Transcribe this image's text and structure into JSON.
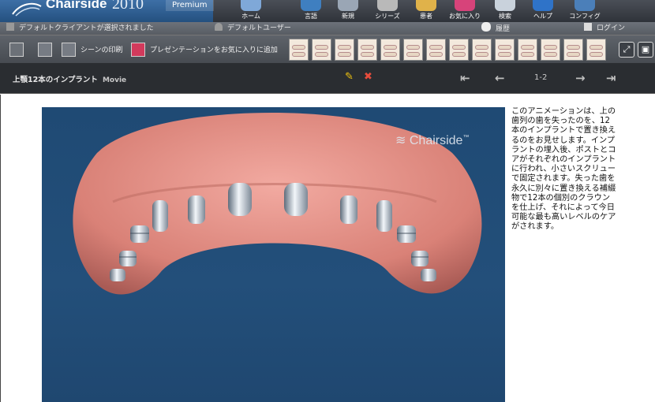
{
  "header": {
    "brand_name": "Chairside",
    "brand_year": "2010",
    "edition": "Premium",
    "nav": [
      {
        "label": "ホーム",
        "icon": "home-icon"
      },
      {
        "label": "言語",
        "icon": "language-icon"
      },
      {
        "label": "新規",
        "icon": "new-icon"
      },
      {
        "label": "シリーズ",
        "icon": "series-icon"
      },
      {
        "label": "患者",
        "icon": "patient-icon"
      },
      {
        "label": "お気に入り",
        "icon": "favorites-icon"
      },
      {
        "label": "検索",
        "icon": "search-icon"
      },
      {
        "label": "ヘルプ",
        "icon": "help-icon"
      },
      {
        "label": "コンフィグ",
        "icon": "config-icon"
      }
    ]
  },
  "status": {
    "client": "デフォルトクライアントが選択されました",
    "user": "デフォルトユーザー",
    "history": "履歴",
    "login": "ログイン"
  },
  "toolbar": {
    "print_label": "シーンの印刷",
    "favorite_label": "プレゼンテーションをお気に入りに追加",
    "thumbnail_count": 14
  },
  "scene": {
    "title": "上顎12本のインプラント",
    "type": "Movie",
    "page": "1-2"
  },
  "viewer": {
    "watermark": "Chairside"
  },
  "description": "このアニメーションは、上の歯列の歯を失ったのを、12本のインプラントで置き換えるのをお見せします。インプラントの埋入後、ポストとコアがそれぞれのインプラントに行われ、小さいスクリューで固定されます。失った歯を永久に別々に置き換える補綴物で12本の個別のクラウンを仕上げ、それによって今日可能な最も高いレベルのケアがされます。",
  "colors": {
    "viewer_bg": "#234f7a",
    "gum": "#e9978f",
    "implant": "#c9d4de",
    "accent_blue": "#2d5d91"
  }
}
